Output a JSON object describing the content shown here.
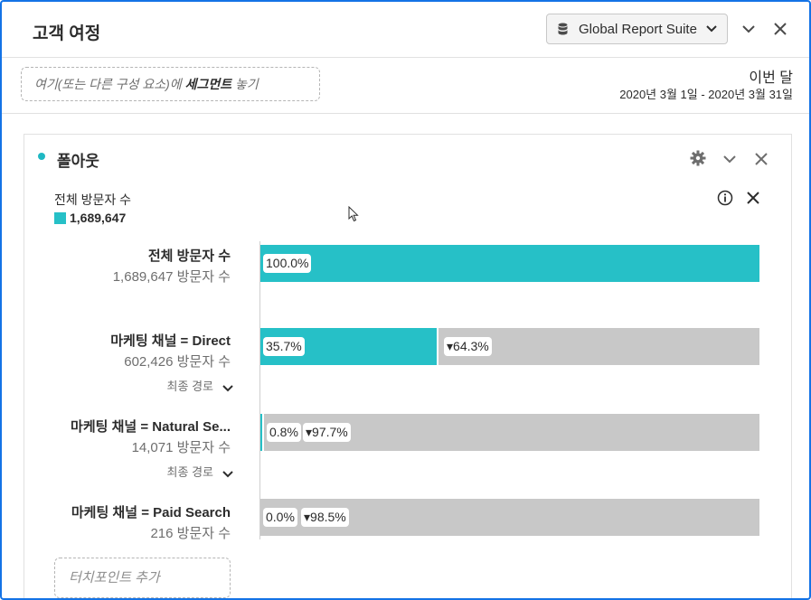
{
  "header": {
    "title": "고객 여정",
    "suite_label": "Global Report Suite",
    "icons": [
      "database-icon",
      "chevron-down-icon",
      "collapse-chevron-icon",
      "close-icon"
    ]
  },
  "segment_bar": {
    "placeholder_prefix": "여기(또는 다른 구성 요소)에 ",
    "placeholder_bold": "세그먼트",
    "placeholder_suffix": " 놓기",
    "date_title": "이번 달",
    "date_range": "2020년 3월 1일 - 2020년 3월 31일"
  },
  "panel": {
    "title": "폴아웃",
    "icons": [
      "gear-icon",
      "chevron-down-icon",
      "close-icon",
      "info-icon",
      "close-icon"
    ],
    "legend": {
      "title": "전체 방문자 수",
      "value": "1,689,647",
      "color": "#26c0c7"
    },
    "steps": [
      {
        "name": "전체 방문자 수",
        "count": "1,689,647 방문자 수",
        "fill_pct": 100.0,
        "percent_label": "100.0%",
        "fallout_label": "",
        "path_label": ""
      },
      {
        "name": "마케팅 채널 = Direct",
        "count": "602,426 방문자 수",
        "fill_pct": 35.7,
        "percent_label": "35.7%",
        "fallout_label": "▾64.3%",
        "path_label": "최종 경로"
      },
      {
        "name": "마케팅 채널 = Natural Se...",
        "count": "14,071 방문자 수",
        "fill_pct": 0.8,
        "percent_label": "0.8%",
        "fallout_label": "▾97.7%",
        "path_label": "최종 경로"
      },
      {
        "name": "마케팅 채널 = Paid Search",
        "count": "216 방문자 수",
        "fill_pct": 0.0,
        "percent_label": "0.0%",
        "fallout_label": "▾98.5%",
        "path_label": ""
      }
    ],
    "add_touchpoint": "터치포인트 추가"
  },
  "colors": {
    "accent": "#26c0c7",
    "window_border": "#1473e6",
    "bar_background": "#c8c8c8"
  }
}
